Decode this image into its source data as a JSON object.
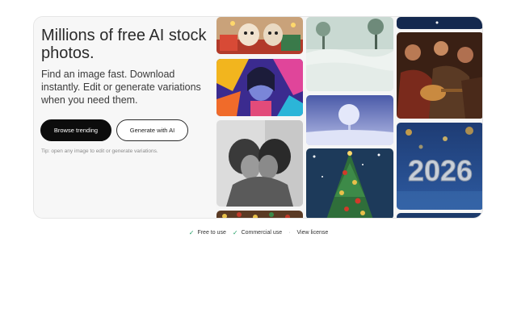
{
  "hero": {
    "title": "Millions of free AI stock photos.",
    "subtitle": "Find an image fast. Download instantly. Edit or generate variations when you need them.",
    "browse_label": "Browse trending",
    "generate_label": "Generate with AI",
    "tip": "Tip: open any image to edit or generate variations."
  },
  "gallery": {
    "tiles": [
      {
        "icon": "puppy-kitten-photo"
      },
      {
        "icon": "colorful-portrait-photo"
      },
      {
        "icon": "black-white-couple-photo"
      },
      {
        "icon": "christmas-lights-photo"
      },
      {
        "icon": "snowy-field-photo"
      },
      {
        "icon": "winter-tree-photo"
      },
      {
        "icon": "christmas-tree-photo"
      },
      {
        "icon": "night-sky-photo"
      },
      {
        "icon": "musicians-painting-photo"
      },
      {
        "icon": "new-year-2026-photo"
      },
      {
        "icon": "blue-strip-photo"
      }
    ],
    "year_text": "2026"
  },
  "footer": {
    "free_label": "Free to use",
    "commercial_label": "Commercial use",
    "license_label": "View license",
    "separator": "·",
    "check_color": "#2aa36b"
  },
  "colors": {
    "primary_button": "#0c0c0c",
    "hero_bg": "#f7f7f7"
  }
}
